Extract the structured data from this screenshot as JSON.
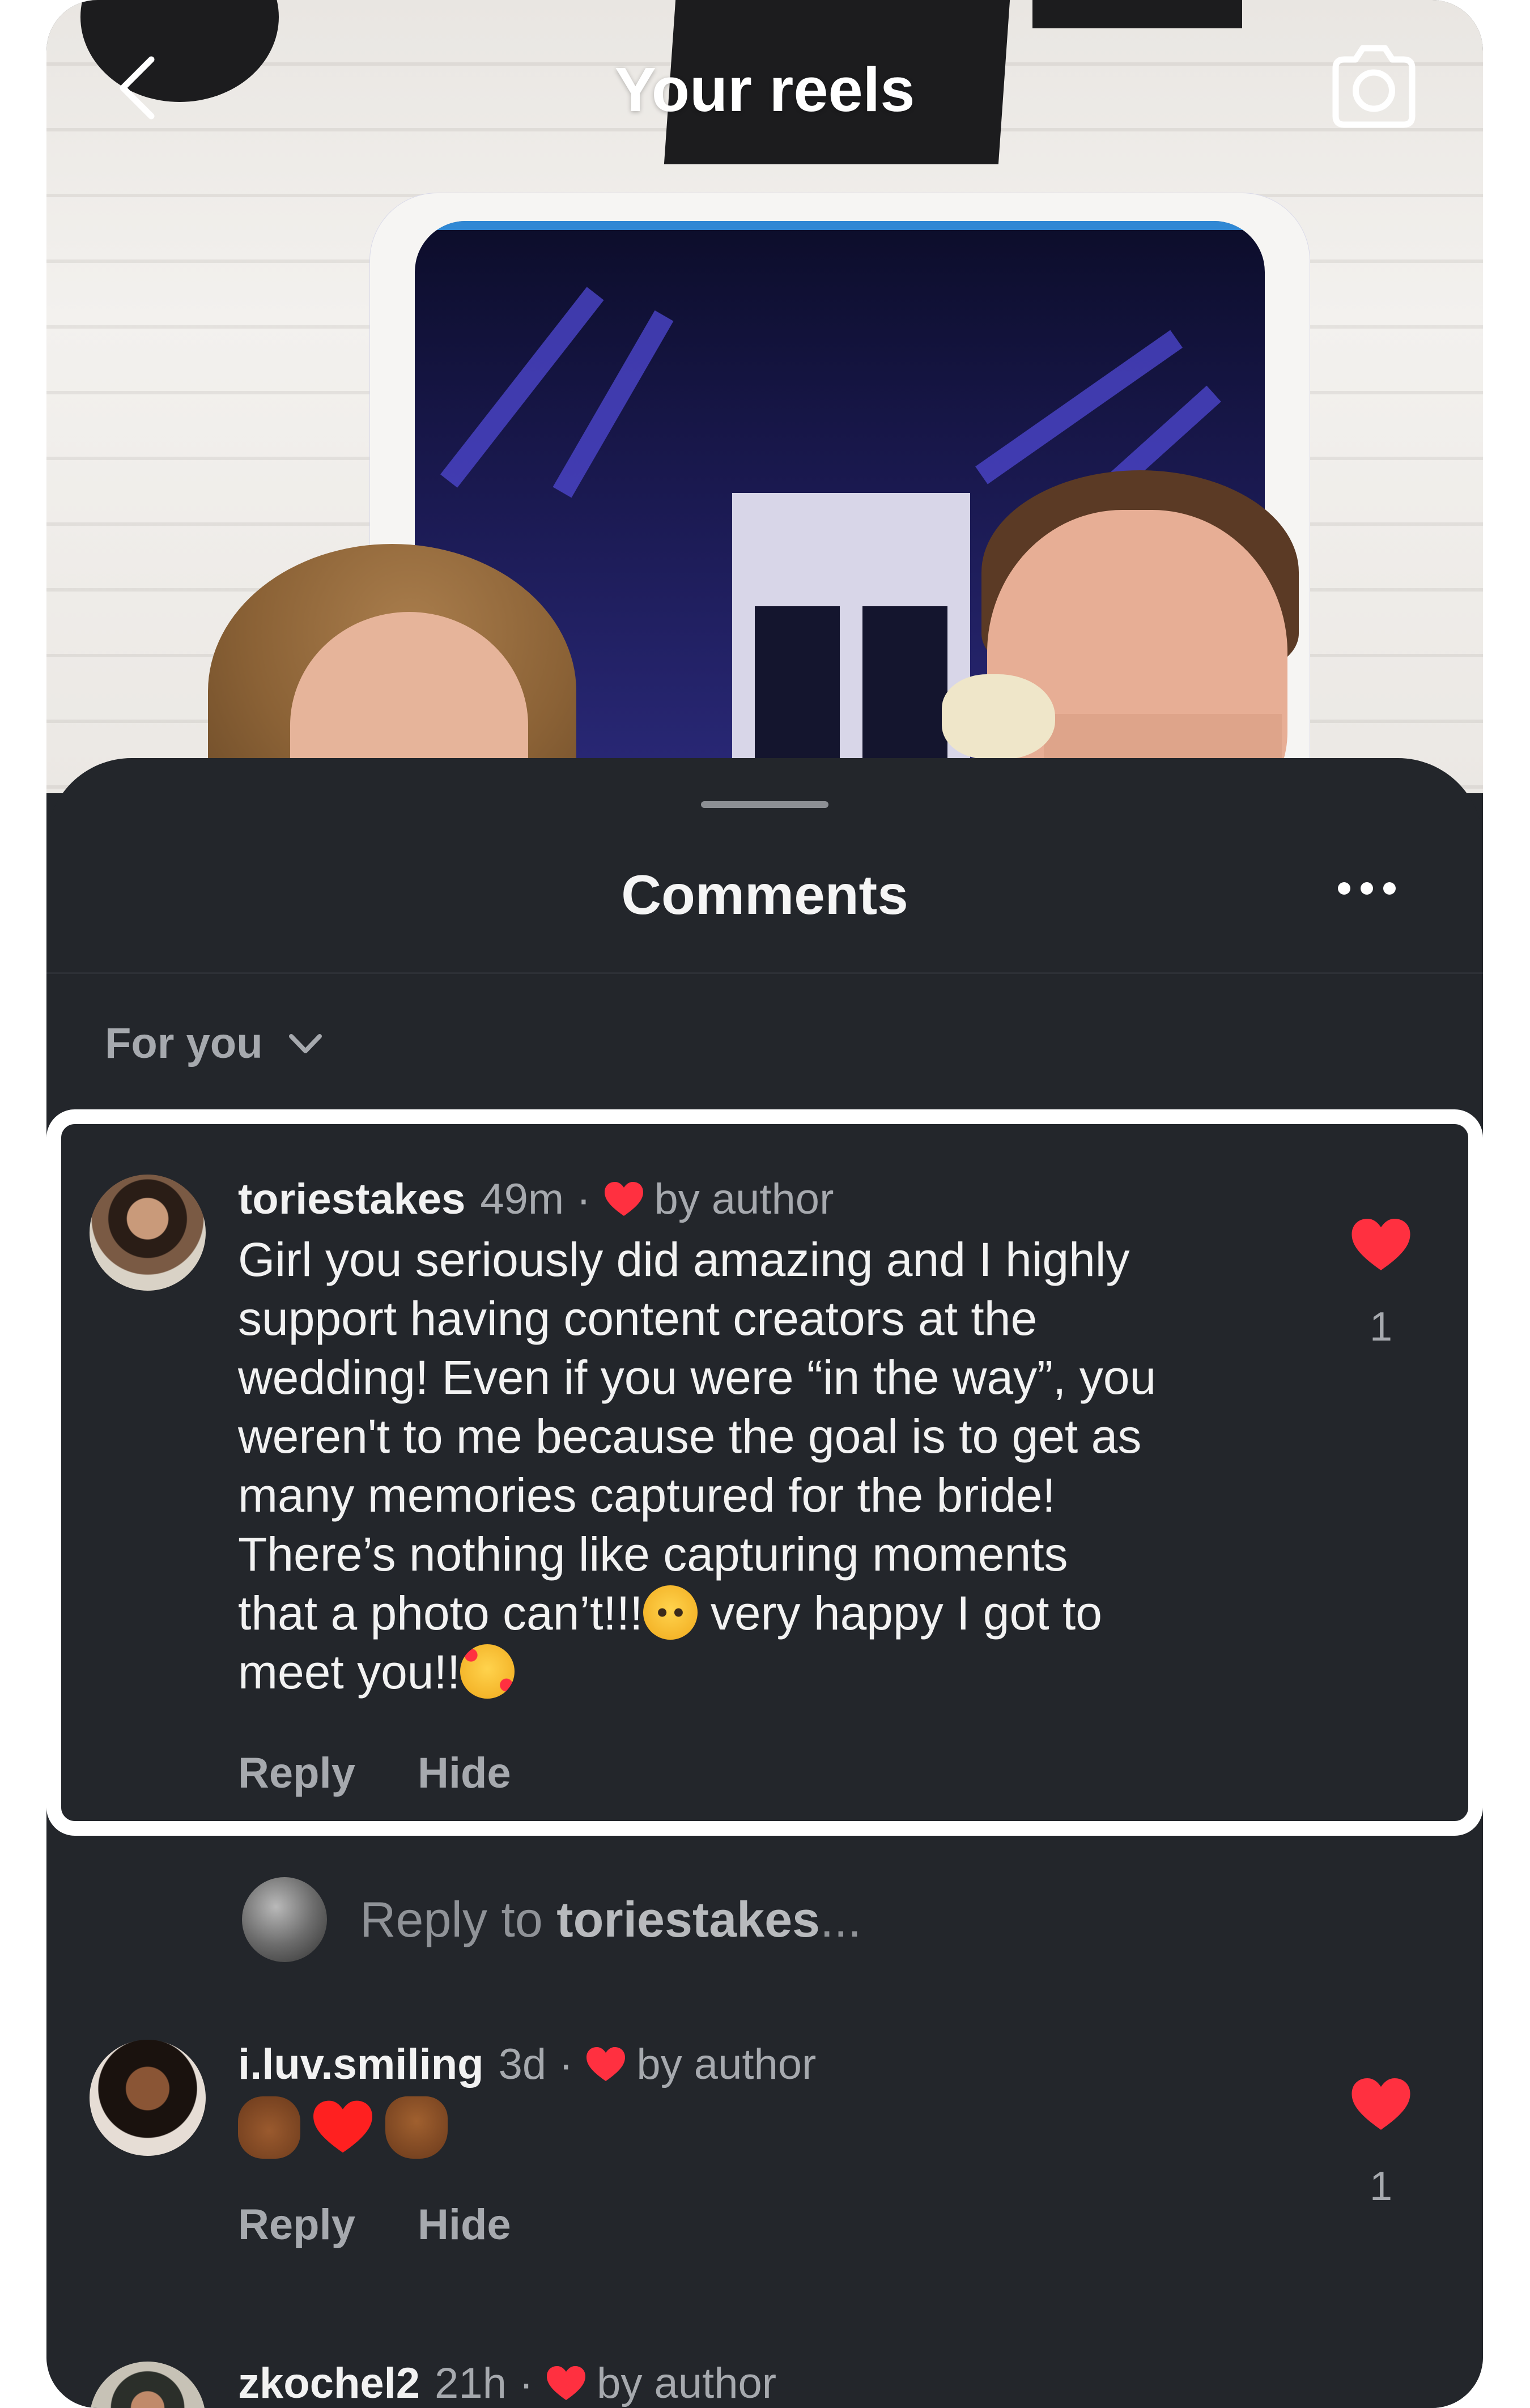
{
  "topbar": {
    "title": "Your reels"
  },
  "sheet": {
    "title": "Comments",
    "filter_label": "For you"
  },
  "comments": [
    {
      "username": "toriestakes",
      "time": "49m",
      "separator": "·",
      "badge": "by author",
      "text_lines": [
        "Girl you seriously did amazing and I highly",
        "support having content creators at the",
        "wedding! Even if you were “in the way”, you",
        "weren't to me because the goal is to get as",
        "many memories captured for the bride!",
        "There’s nothing like capturing moments",
        "that a photo can’t!!!",
        " very happy I got to",
        "meet you!!"
      ],
      "emojis": [
        "pleading-face-emoji",
        "smiling-face-with-hearts-emoji"
      ],
      "reply_label": "Reply",
      "hide_label": "Hide",
      "likes": "1"
    },
    {
      "username": "i.luv.smiling",
      "time": "3d",
      "separator": "·",
      "badge": "by author",
      "emojis": [
        "clapping-hands-emoji",
        "red-heart-emoji",
        "raising-hands-emoji"
      ],
      "reply_label": "Reply",
      "hide_label": "Hide",
      "likes": "1"
    },
    {
      "username": "zkochel2",
      "time": "21h",
      "separator": "·",
      "badge": "by author"
    }
  ],
  "reply_input": {
    "prefix": "Reply to ",
    "target": "toriestakes",
    "suffix": "..."
  },
  "colors": {
    "sheet_bg": "#23262b",
    "heart": "#ff3040",
    "text_primary": "#f2f2f2",
    "text_secondary": "#a6a9ae",
    "highlight_border": "#ffffff"
  }
}
